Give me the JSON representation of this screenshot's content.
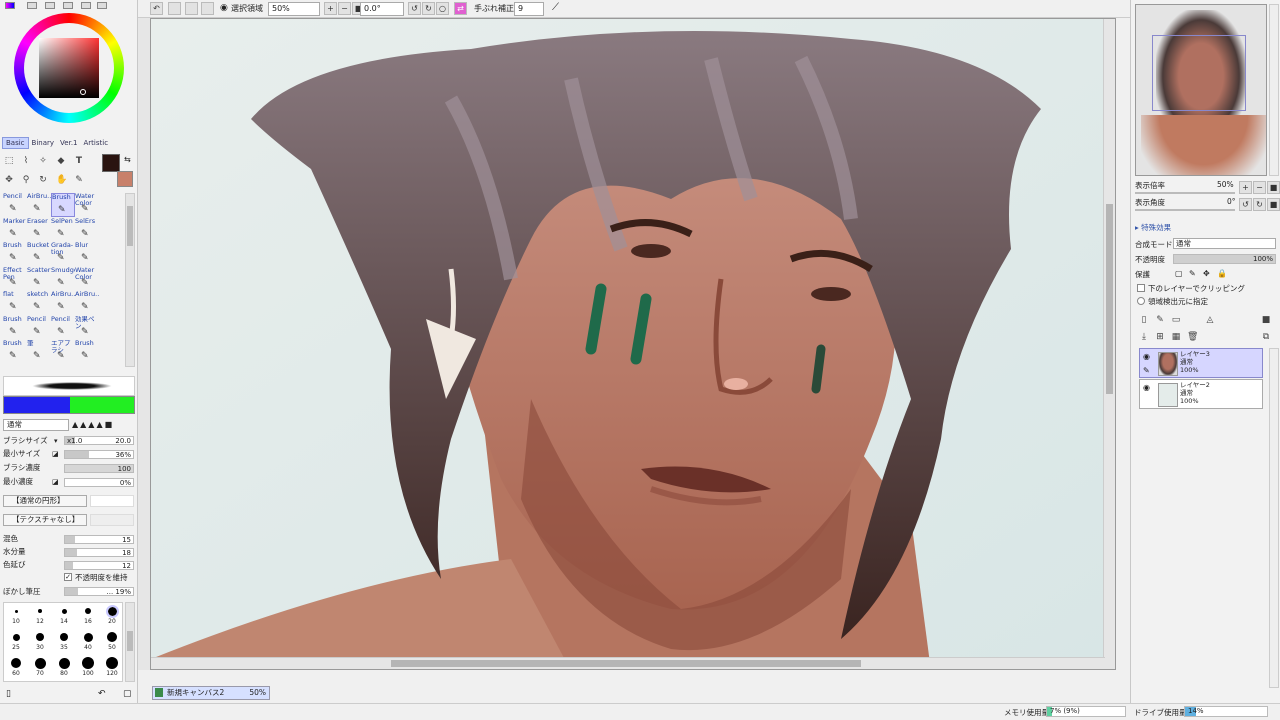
{
  "toolbar": {
    "selection_label": "選択領域",
    "zoom_value": "50%",
    "angle_value": "0.0°",
    "stabilizer_label": "手ぶれ補正",
    "stabilizer_value": "9"
  },
  "left": {
    "tabs": [
      "Basic",
      "Binary",
      "Ver.1",
      "Artistic"
    ],
    "tools": [
      {
        "label": "Pencil"
      },
      {
        "label": "AirBru..."
      },
      {
        "label": "Brush"
      },
      {
        "label": "Water Color"
      },
      {
        "label": "Marker"
      },
      {
        "label": "Eraser"
      },
      {
        "label": "SelPen"
      },
      {
        "label": "SelErs"
      },
      {
        "label": "Brush"
      },
      {
        "label": "Bucket"
      },
      {
        "label": "Grada- tion"
      },
      {
        "label": "Blur"
      },
      {
        "label": "Effect Pen"
      },
      {
        "label": "Scatter"
      },
      {
        "label": "Smudge"
      },
      {
        "label": "Water Color"
      },
      {
        "label": "flat"
      },
      {
        "label": "sketch"
      },
      {
        "label": "AirBru..."
      },
      {
        "label": "AirBru..."
      },
      {
        "label": "Brush"
      },
      {
        "label": "Pencil"
      },
      {
        "label": "Pencil"
      },
      {
        "label": "効果ペン"
      },
      {
        "label": "Brush"
      },
      {
        "label": "筆"
      },
      {
        "label": "エアブラシ"
      },
      {
        "label": "Brush"
      }
    ],
    "blend_mode": "通常",
    "brush_size_label": "ブラシサイズ",
    "brush_size_mult": "x1.0",
    "brush_size_value": "20.0",
    "min_size_label": "最小サイズ",
    "min_size_value": "36%",
    "density_label": "ブラシ濃度",
    "density_value": "100",
    "min_density_label": "最小濃度",
    "min_density_value": "0%",
    "shape_label": "【通常の円形】",
    "texture_label": "【テクスチャなし】",
    "mix_label": "混色",
    "mix_value": "15",
    "water_label": "水分量",
    "water_value": "18",
    "stretch_label": "色延び",
    "stretch_value": "12",
    "keep_opacity_label": "不透明度を維持",
    "blur_label": "ぼかし筆圧",
    "blur_value": "... 19%",
    "dot_sizes": [
      "10",
      "12",
      "14",
      "16",
      "20",
      "25",
      "30",
      "35",
      "40",
      "50",
      "60",
      "70",
      "80",
      "100",
      "120"
    ]
  },
  "right": {
    "zoom_label": "表示倍率",
    "zoom_value": "50%",
    "angle_label": "表示角度",
    "angle_value": "0°",
    "effects_label": "特殊効果",
    "blend_label": "合成モード",
    "blend_value": "通常",
    "opacity_label": "不透明度",
    "opacity_value": "100%",
    "protect_label": "保護",
    "clip_label": "下のレイヤーでクリッピング",
    "detect_label": "領域検出元に指定",
    "layers": [
      {
        "name": "レイヤー3",
        "mode": "通常",
        "opacity": "100%"
      },
      {
        "name": "レイヤー2",
        "mode": "通常",
        "opacity": "100%"
      }
    ]
  },
  "status": {
    "canvas_tab": "新規キャンバス2",
    "canvas_zoom": "50%",
    "memory_label": "メモリ使用量",
    "memory_value": "7% (9%)",
    "drive_label": "ドライブ使用量",
    "drive_value": "14%"
  },
  "colors": {
    "primary": "#2a1410",
    "secondary": "#c8806a",
    "selected_bg": "#d8d8ff"
  }
}
